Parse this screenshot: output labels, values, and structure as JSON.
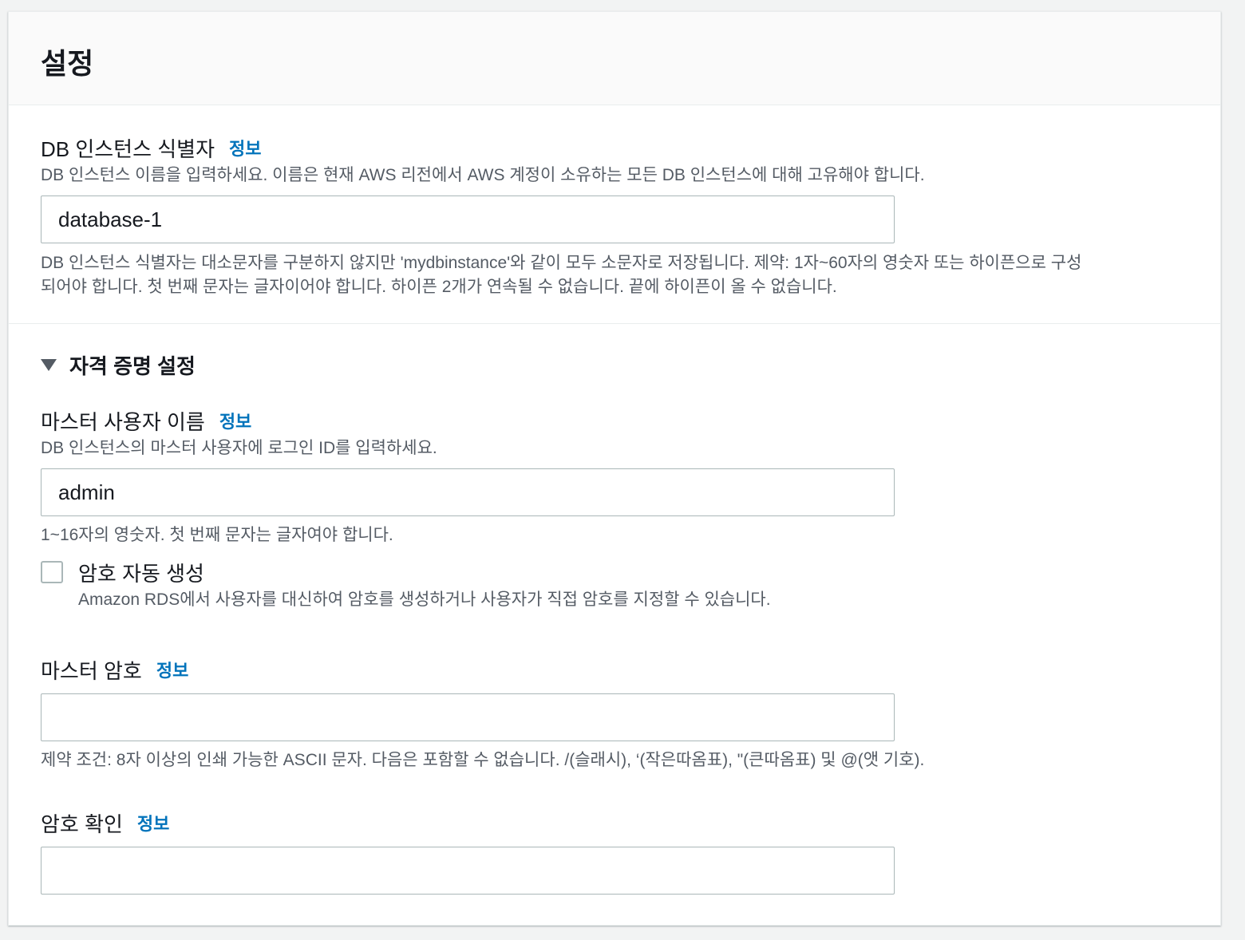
{
  "panel": {
    "title": "설정"
  },
  "identifier": {
    "label": "DB 인스턴스 식별자",
    "info": "정보",
    "description": "DB 인스턴스 이름을 입력하세요. 이름은 현재 AWS 리전에서 AWS 계정이 소유하는 모든 DB 인스턴스에 대해 고유해야 합니다.",
    "value": "database-1",
    "constraint_line1": "DB 인스턴스 식별자는 대소문자를 구분하지 않지만 'mydbinstance'와 같이 모두 소문자로 저장됩니다. 제약: 1자~60자의 영숫자 또는 하이픈으로 구성",
    "constraint_line2": "되어야 합니다. 첫 번째 문자는 글자이어야 합니다. 하이픈 2개가 연속될 수 없습니다. 끝에 하이픈이 올 수 없습니다."
  },
  "credentials": {
    "section_label": "자격 증명 설정",
    "master_username": {
      "label": "마스터 사용자 이름",
      "info": "정보",
      "description": "DB 인스턴스의 마스터 사용자에 로그인 ID를 입력하세요.",
      "value": "admin",
      "constraint": "1~16자의 영숫자. 첫 번째 문자는 글자여야 합니다."
    },
    "auto_password": {
      "label": "암호 자동 생성",
      "description": "Amazon RDS에서 사용자를 대신하여 암호를 생성하거나 사용자가 직접 암호를 지정할 수 있습니다.",
      "checked": false
    },
    "master_password": {
      "label": "마스터 암호",
      "info": "정보",
      "value": "",
      "constraint": "제약 조건: 8자 이상의 인쇄 가능한 ASCII 문자. 다음은 포함할 수 없습니다. /(슬래시), ‘(작은따옴표), \"(큰따옴표) 및 @(앳 기호)."
    },
    "confirm_password": {
      "label": "암호 확인",
      "info": "정보",
      "value": ""
    }
  },
  "colors": {
    "link": "#0073bb",
    "secondary_text": "#545b64",
    "border": "#aab7b8"
  }
}
